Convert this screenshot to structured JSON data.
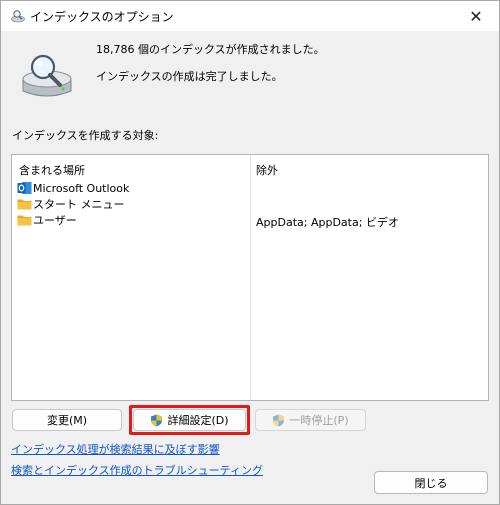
{
  "window": {
    "title": "インデックスのオプション",
    "close_glyph": "✕"
  },
  "status": {
    "items_indexed": "18,786 個のインデックスが作成されました。",
    "state": "インデックスの作成は完了しました。"
  },
  "locations": {
    "section_label": "インデックスを作成する対象:",
    "columns": {
      "included": "含まれる場所",
      "excluded": "除外"
    },
    "rows": [
      {
        "name": "Microsoft Outlook",
        "icon": "outlook-icon",
        "excluded": ""
      },
      {
        "name": "スタート メニュー",
        "icon": "folder-icon",
        "excluded": ""
      },
      {
        "name": "ユーザー",
        "icon": "folder-icon",
        "excluded": "AppData; AppData; ビデオ"
      }
    ]
  },
  "buttons": {
    "modify": "変更(M)",
    "advanced": "詳細設定(D)",
    "pause": "一時停止(P)",
    "close": "閉じる"
  },
  "links": {
    "impact": "インデックス処理が検索結果に及ぼす影響",
    "troubleshoot": "検索とインデックス作成のトラブルシューティング"
  },
  "colors": {
    "highlight": "#e21a1a",
    "link": "#1155cc",
    "folder": "#f6c244",
    "outlook": "#0a64c6"
  }
}
